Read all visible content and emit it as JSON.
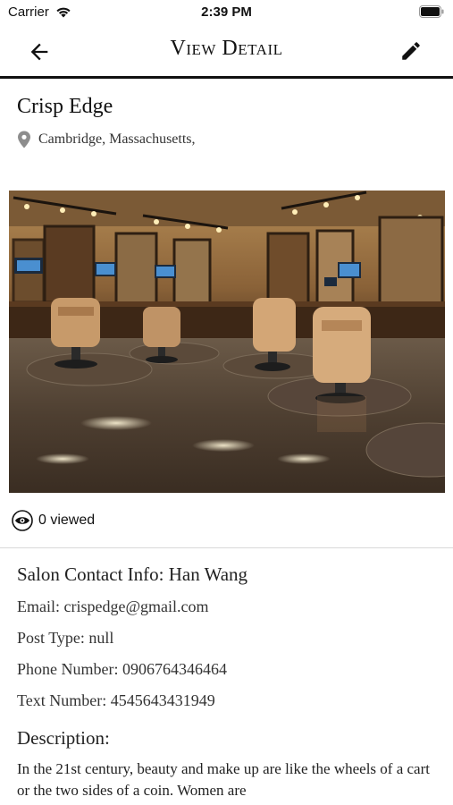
{
  "status_bar": {
    "carrier": "Carrier",
    "time": "2:39 PM"
  },
  "nav": {
    "title": "View Detail",
    "back_icon": "arrow-left-icon",
    "edit_icon": "pencil-icon"
  },
  "salon": {
    "name": "Crisp Edge",
    "location": "Cambridge, Massachusetts,",
    "views": "0 viewed"
  },
  "contact": {
    "contact_info": "Salon Contact Info: Han Wang",
    "email": "Email: crispedge@gmail.com",
    "post_type": "Post Type: null",
    "phone": "Phone Number: 0906764346464",
    "text_number": "Text Number: 4545643431949"
  },
  "description": {
    "label": "Description:",
    "text": "In the 21st century, beauty and make up are like the wheels of a cart or the two sides of a coin. Women are"
  }
}
